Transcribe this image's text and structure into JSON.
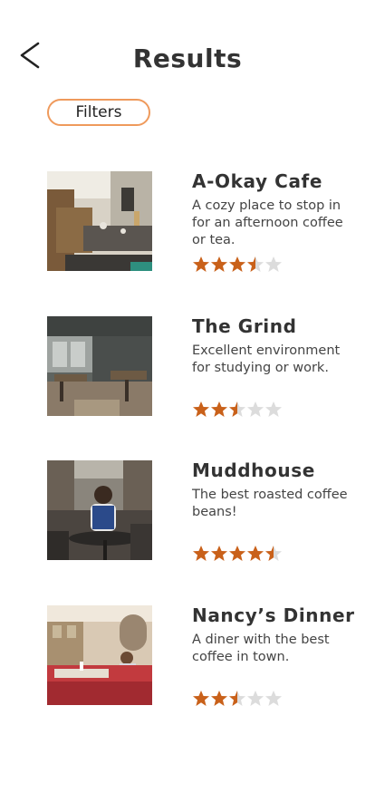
{
  "header": {
    "title": "Results",
    "back_icon": "chevron-left-icon"
  },
  "filters": {
    "label": "Filters",
    "border_color": "#ef9a5c"
  },
  "rating_colors": {
    "filled": "#c9611a",
    "empty": "#dcdcdc"
  },
  "results": [
    {
      "name": "A-Okay Cafe",
      "description": "A cozy place to stop in for an afternoon coffee or tea.",
      "rating": 3.5,
      "max_rating": 5,
      "image": "cafe-interior-photo"
    },
    {
      "name": "The Grind",
      "description": "Excellent environment for studying or work.",
      "rating": 2.5,
      "max_rating": 5,
      "image": "cafe-interior-photo"
    },
    {
      "name": "Muddhouse",
      "description": "The best roasted coffee beans!",
      "rating": 4.5,
      "max_rating": 5,
      "image": "cafe-patron-photo"
    },
    {
      "name": "Nancy’s Dinner",
      "description": "A diner with the best coffee in town.",
      "rating": 2.5,
      "max_rating": 5,
      "image": "diner-interior-photo"
    }
  ]
}
